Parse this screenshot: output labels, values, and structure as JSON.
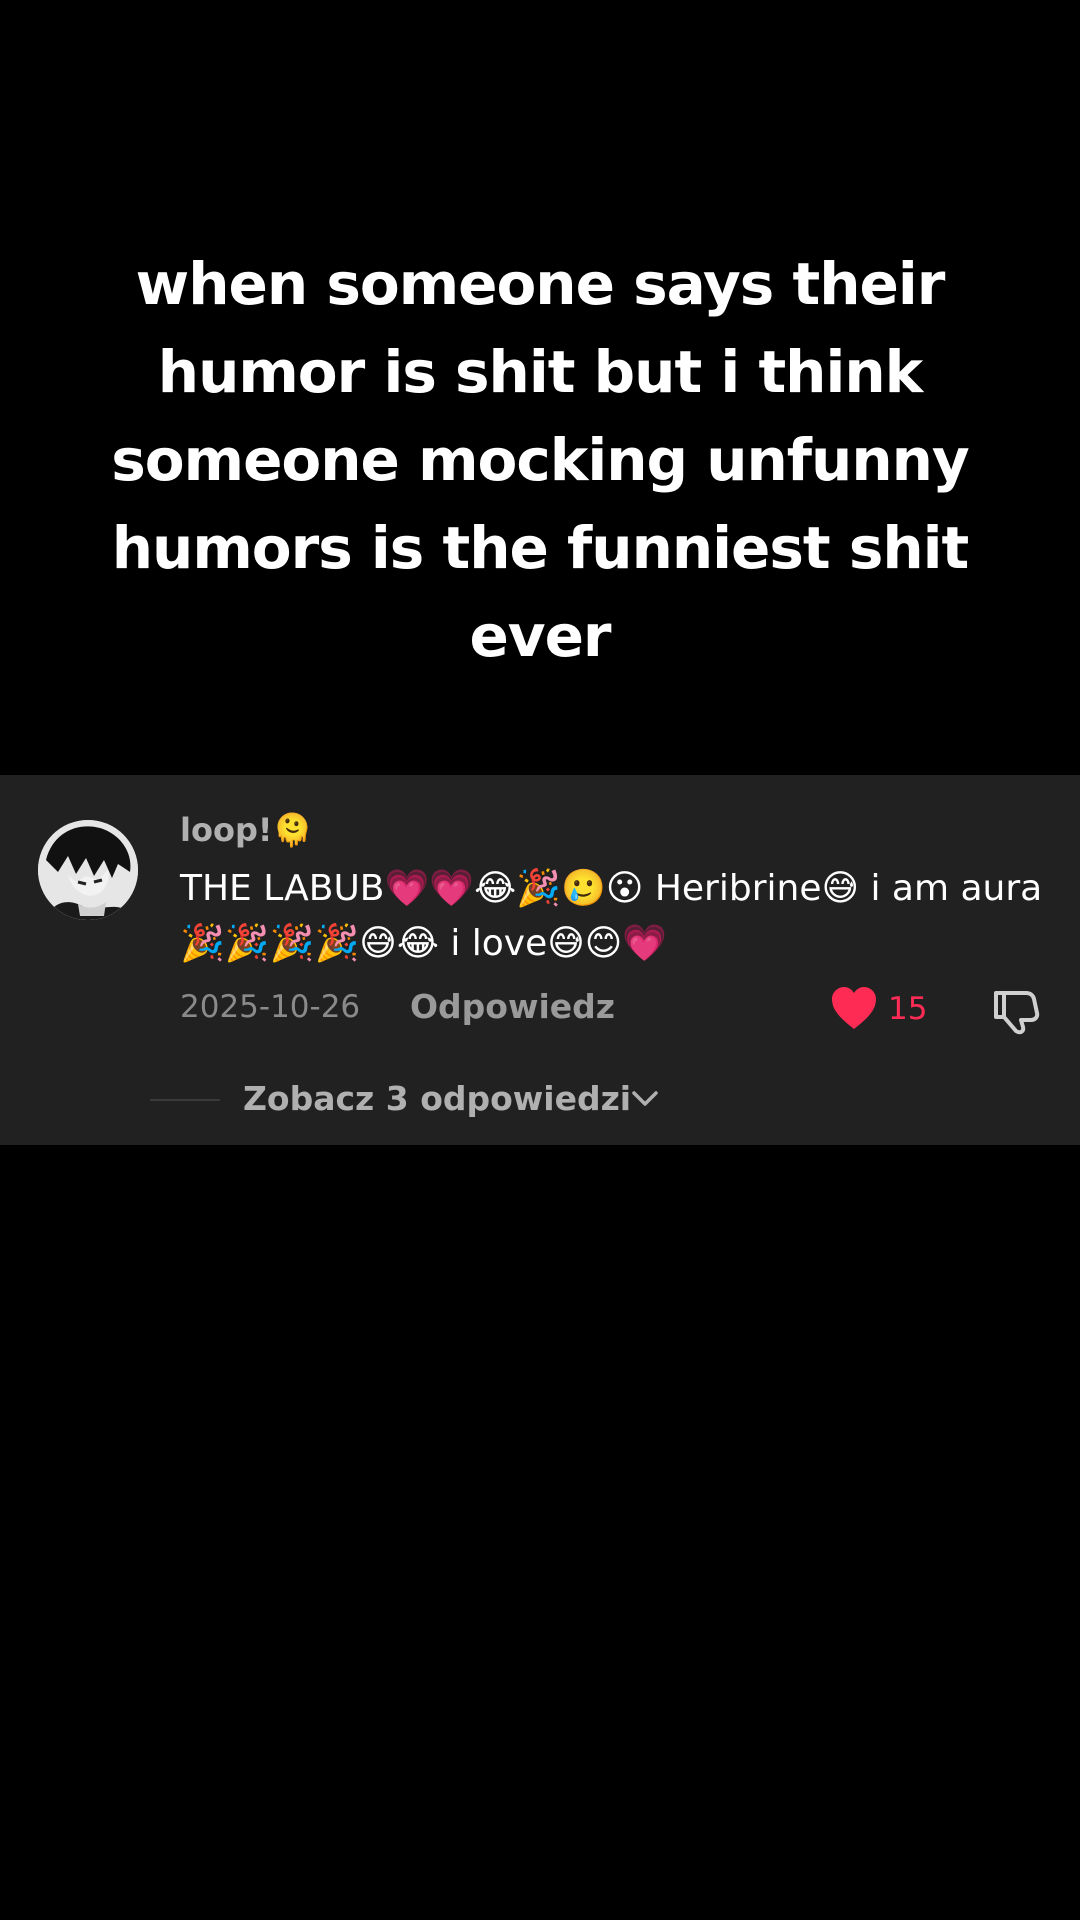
{
  "video": {
    "caption": "when someone says their humor is shit but i think someone mocking unfunny humors is the funniest shit ever"
  },
  "comment": {
    "username": "loop!🫠",
    "text": "THE LABUB💗💗😂🎉🥲😮 Heribrine😅 i am aura🎉🎉🎉🎉😅😂 i love😅😊💗",
    "date": "2025-10-26",
    "reply_label": "Odpowiedz",
    "like_count": "15",
    "view_replies_label": "Zobacz 3 odpowiedzi"
  },
  "colors": {
    "background": "#000000",
    "panel": "#212121",
    "like_accent": "#fe2c55"
  },
  "icons": {
    "like": "heart-icon",
    "dislike": "dislike-icon",
    "expand": "chevron-down-icon",
    "avatar": "avatar"
  }
}
